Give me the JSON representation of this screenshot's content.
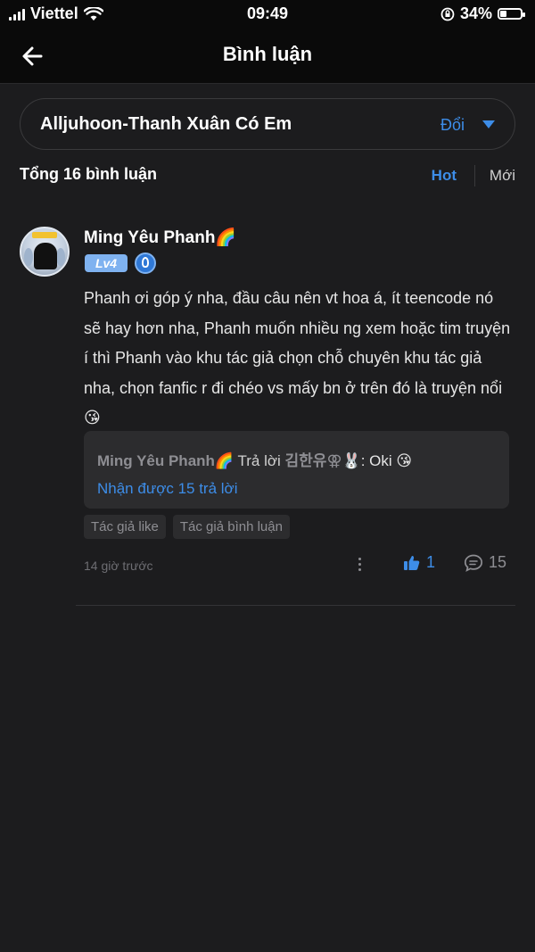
{
  "status_bar": {
    "carrier": "Viettel",
    "time": "09:49",
    "battery": "34%",
    "battery_level": 0.34
  },
  "header": {
    "title": "Bình luận"
  },
  "selector": {
    "story_title": "Alljuhoon-Thanh Xuân Có Em",
    "change_label": "Đổi"
  },
  "comments_summary": {
    "count_label": "Tổng 16 bình luận",
    "sort_hot": "Hot",
    "sort_new": "Mới"
  },
  "comment": {
    "username": "Ming Yêu Phanh🌈",
    "level": "Lv4",
    "text": "Phanh ơi góp ý nha, đầu câu nên vt hoa á, ít teencode nó sẽ hay hơn nha, Phanh muốn nhiều ng xem hoặc tim truyện í thì Phanh vào khu tác giả chọn chỗ chuyên khu tác giả nha, chọn fanfic r đi chéo vs mấy bn ở trên đó là truyện nổi 😘",
    "reply": {
      "author": "Ming Yêu Phanh🌈",
      "verb": " Trả lời ",
      "target": "김한유⚢🐰",
      "text": ": Oki 😘",
      "more_label": "Nhận được 15 trả lời"
    },
    "tags": [
      "Tác giả like",
      "Tác giả bình luận"
    ],
    "time": "14 giờ trước",
    "likes": "1",
    "reply_count": "15"
  },
  "colors": {
    "accent": "#3d8de8",
    "background": "#1c1c1e",
    "bar": "#0a0a0a",
    "card": "#2c2c2e"
  }
}
